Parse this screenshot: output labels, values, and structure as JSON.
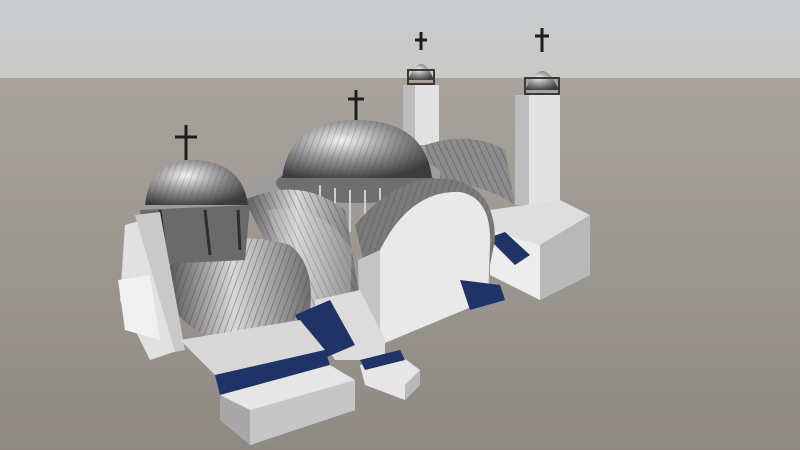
{
  "scene": {
    "subject": "church-model",
    "colors": {
      "sky_top": "#c9cfd3",
      "sky_horizon": "#c8c6c0",
      "ground_near": "#a29e97",
      "ground_far": "#8f8b84",
      "wall_light": "#e6e6e6",
      "wall_shade": "#bdbdbd",
      "wall_dark": "#9a9a9a",
      "metal_light": "#d8d8d8",
      "metal_mid": "#8a8a8a",
      "metal_dark": "#4a4a4a",
      "window_blue": "#1f3366",
      "cross": "#1e1e1e"
    }
  }
}
